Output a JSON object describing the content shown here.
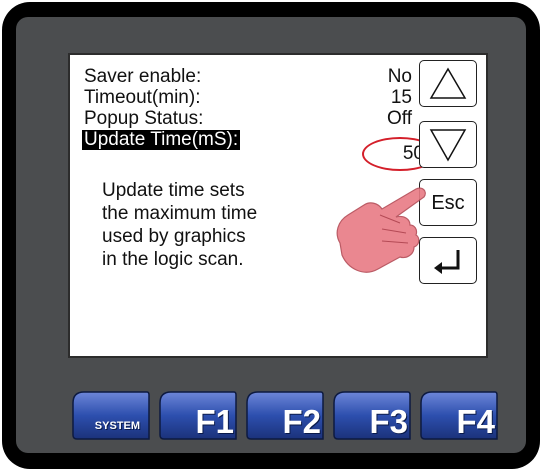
{
  "screen": {
    "settings": [
      {
        "label": "Saver enable:",
        "value": "No"
      },
      {
        "label": "Timeout(min):",
        "value": "15"
      },
      {
        "label": "Popup Status:",
        "value": "Off"
      },
      {
        "label": "Update Time(mS):",
        "value": "50"
      }
    ],
    "help_text": [
      "Update time sets",
      "the maximum time",
      "used by graphics",
      "in the logic scan."
    ]
  },
  "side_buttons": {
    "up": "up-arrow-icon",
    "down": "down-arrow-icon",
    "esc_label": "Esc",
    "enter": "enter-icon"
  },
  "function_keys": [
    {
      "label": "SYSTEM"
    },
    {
      "label": "F1"
    },
    {
      "label": "F2"
    },
    {
      "label": "F3"
    },
    {
      "label": "F4"
    }
  ],
  "colors": {
    "bezel": "#000000",
    "panel": "#4b4d4f",
    "screen": "#ffffff",
    "highlight_circle": "#d41f2a",
    "hand": "#e87b84",
    "fkey": "#2d4fae"
  }
}
